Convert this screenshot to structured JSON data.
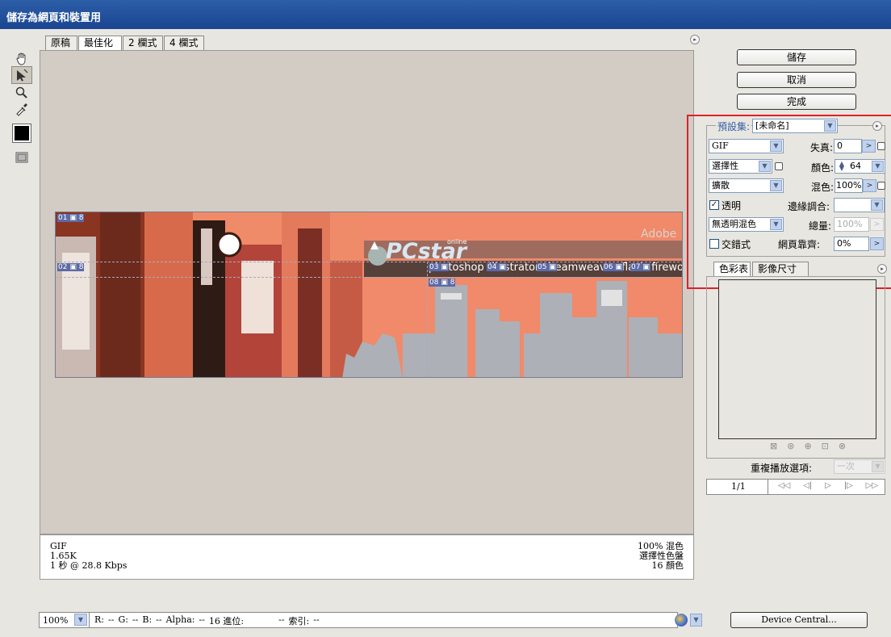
{
  "window": {
    "title": "儲存為網頁和裝置用"
  },
  "tabs": [
    {
      "label": "原稿"
    },
    {
      "label": "最佳化"
    },
    {
      "label": "2 欄式"
    },
    {
      "label": "4 欄式"
    }
  ],
  "banner": {
    "brand": "PCstar",
    "brand_super": "online",
    "adobe": "Adobe",
    "nav": [
      "photoshop",
      "illustrator",
      "dreamweaver",
      "flash",
      "fireworks"
    ],
    "slices": [
      "01",
      "02",
      "03",
      "04",
      "05",
      "06",
      "07",
      "08"
    ],
    "slice_mark": "8"
  },
  "info": {
    "format": "GIF",
    "size": "1.65K",
    "speed": "1 秒 @ 28.8 Kbps",
    "dither": "100% 混色",
    "palette": "選擇性色盤",
    "colors": "16 顏色"
  },
  "statusbar": {
    "zoom": "100%",
    "r": "R:",
    "r_val": "--",
    "g": "G:",
    "g_val": "--",
    "b": "B:",
    "b_val": "--",
    "alpha": "Alpha:",
    "alpha_val": "--",
    "hex": "16 進位:",
    "hex_val": "--",
    "index": "索引:",
    "index_val": "--"
  },
  "buttons": {
    "save": "儲存",
    "cancel": "取消",
    "done": "完成",
    "device_central": "Device Central..."
  },
  "settings": {
    "preset_label": "預設集:",
    "preset_value": "[未命名]",
    "format_value": "GIF",
    "lossy_label": "失真:",
    "lossy_value": "0",
    "reduction_value": "選擇性",
    "colors_label": "顏色:",
    "colors_value": "64",
    "dither_algo_value": "擴散",
    "dither_label": "混色:",
    "dither_value": "100%",
    "transparency_label": "透明",
    "matte_label": "邊緣調合:",
    "trans_dither_value": "無透明混色",
    "amount_label": "總量:",
    "amount_value": "100%",
    "interlaced_label": "交錯式",
    "websnap_label": "網頁靠齊:",
    "websnap_value": "0%"
  },
  "color_table": {
    "tabs": [
      {
        "label": "色彩表"
      },
      {
        "label": "影像尺寸"
      }
    ]
  },
  "animation": {
    "loop_label": "重複播放選項:",
    "loop_value": "一次",
    "frame": "1/1"
  }
}
